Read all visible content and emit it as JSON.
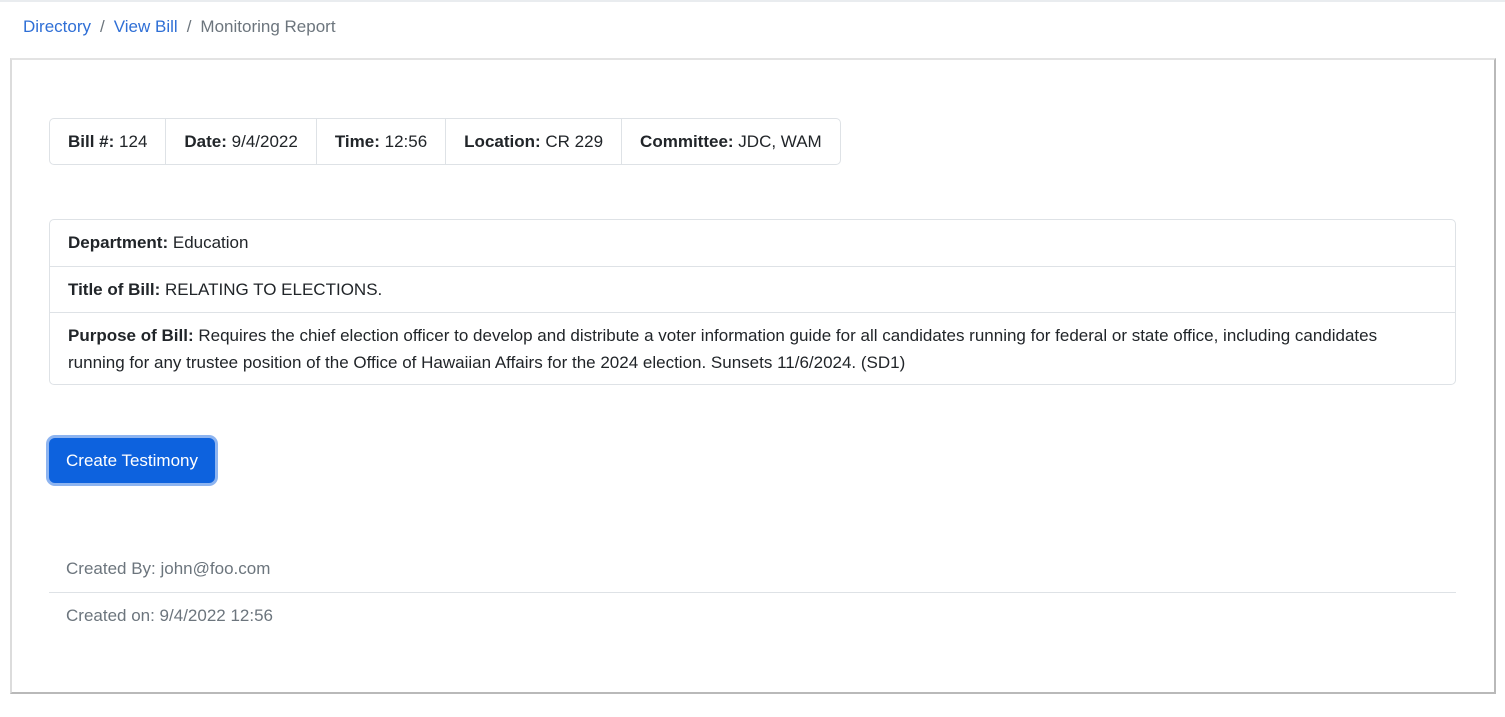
{
  "breadcrumb": {
    "items": [
      {
        "label": "Directory"
      },
      {
        "label": "View Bill"
      }
    ],
    "separator": "/",
    "current": "Monitoring Report"
  },
  "bill_info": {
    "bill_label": "Bill #:",
    "bill_value": "124",
    "date_label": "Date:",
    "date_value": "9/4/2022",
    "time_label": "Time:",
    "time_value": "12:56",
    "location_label": "Location:",
    "location_value": "CR 229",
    "committee_label": "Committee:",
    "committee_value": "JDC, WAM"
  },
  "details": {
    "department_label": "Department:",
    "department_value": "Education",
    "title_label": "Title of Bill:",
    "title_value": "RELATING TO ELECTIONS.",
    "purpose_label": "Purpose of Bill:",
    "purpose_value": "Requires the chief election officer to develop and distribute a voter information guide for all candidates running for federal or state office, including candidates running for any trustee position of the Office of Hawaiian Affairs for the 2024 election. Sunsets 11/6/2024. (SD1)"
  },
  "actions": {
    "create_testimony_label": "Create Testimony"
  },
  "meta": {
    "created_by": "Created By: john@foo.com",
    "created_on": "Created on: 9/4/2022 12:56"
  },
  "colors": {
    "link": "#2f6fd6",
    "primary": "#0d62de",
    "muted": "#6c757d",
    "border": "#dee2e6"
  }
}
